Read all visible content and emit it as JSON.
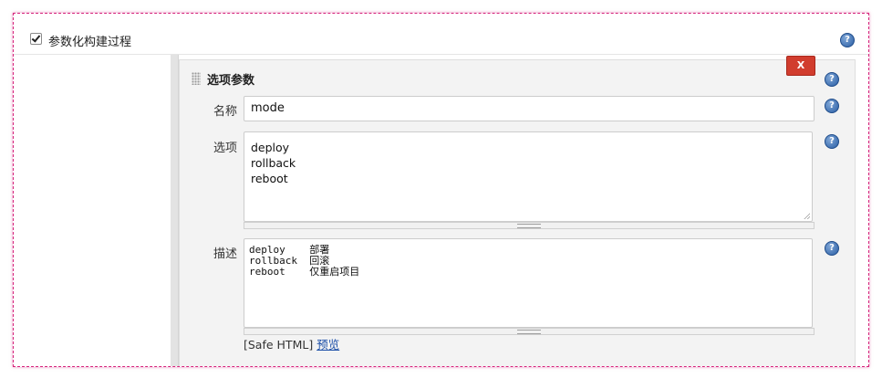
{
  "build": {
    "parameterized_label": "参数化构建过程",
    "parameterized_checked": true
  },
  "param": {
    "title": "选项参数",
    "delete_label": "X",
    "name_label": "名称",
    "name_value": "mode",
    "choices_label": "选项",
    "choices": [
      "deploy",
      "rollback",
      "reboot"
    ],
    "description_label": "描述",
    "description_lines": [
      "deploy    部署",
      "rollback  回滚",
      "reboot    仅重启项目"
    ],
    "safe_html_label": "[Safe HTML]",
    "preview_link": "预览"
  },
  "icons": {
    "help": "question-circle-icon",
    "drag": "drag-handle-icon",
    "resize": "resize-corner-icon"
  },
  "colors": {
    "delete_button": "#d13d2e",
    "help_icon": "#2a5ea5",
    "link": "#1c4fa8",
    "frame_border": "#d6247c"
  }
}
